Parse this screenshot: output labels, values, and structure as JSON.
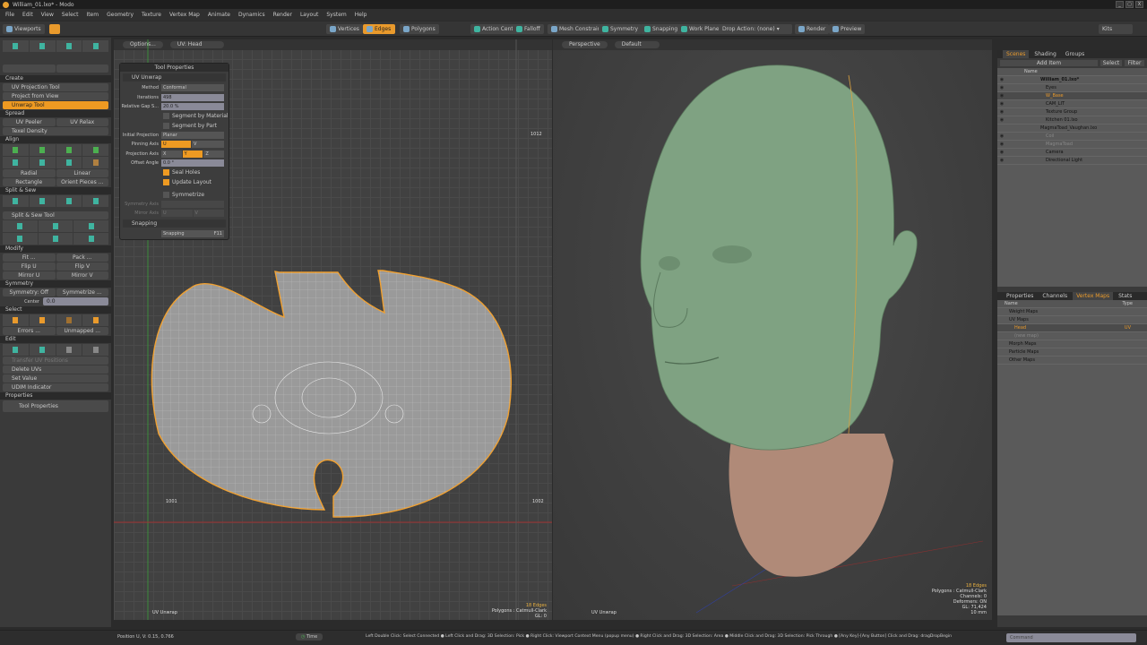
{
  "window": {
    "title": "William_01.lxo* - Modo",
    "buttons": [
      "_",
      "▢",
      "X"
    ]
  },
  "menu": [
    "File",
    "Edit",
    "View",
    "Select",
    "Item",
    "Geometry",
    "Texture",
    "Vertex Map",
    "Animate",
    "Dynamics",
    "Render",
    "Layout",
    "System",
    "Help"
  ],
  "toolbar": {
    "layout": "Viewports",
    "vertices": "Vertices",
    "edges": "Edges",
    "polygons": "Polygons",
    "action_center": "Action Center",
    "falloff": "Falloff",
    "mesh_constraint": "Mesh Constraint",
    "symmetry": "Symmetry",
    "snapping": "Snapping",
    "work_plane": "Work Plane",
    "drop_action": "Drop Action: (none)",
    "render": "Render",
    "preview": "Preview",
    "kits": "Kits"
  },
  "left_panel": {
    "create_header": "Create",
    "create_items": [
      "UV Projection Tool",
      "Project from View",
      "Unwrap Tool"
    ],
    "spread_header": "Spread",
    "uv_peeler": "UV Peeler",
    "uv_relax": "UV Relax",
    "texel_density": "Texel Density",
    "align_header": "Align",
    "radial": "Radial",
    "linear": "Linear",
    "rectangle": "Rectangle",
    "orient_pieces": "Orient Pieces ...",
    "split_header": "Split & Sew",
    "split_tool": "Split & Sew Tool",
    "modify_header": "Modify",
    "fit": "Fit ...",
    "pack": "Pack ...",
    "flip_u": "Flip U",
    "flip_v": "Flip V",
    "mirror_u": "Mirror U",
    "mirror_v": "Mirror V",
    "symmetry_header": "Symmetry",
    "symmetry_off": "Symmetry: Off",
    "symmetrize": "Symmetrize ...",
    "center_label": "Center",
    "center_value": "0.0",
    "select_header": "Select",
    "errors": "Errors ...",
    "unmapped": "Unmapped ...",
    "edit_header": "Edit",
    "transfer": "Transfer UV Positions",
    "delete_uvs": "Delete UVs",
    "set_value": "Set Value",
    "udim": "UDIM Indicator",
    "properties_header": "Properties",
    "tool_properties": "Tool Properties"
  },
  "uv_view": {
    "options": "Options...",
    "map": "UV: Head",
    "label": "UV Unwrap",
    "tick_1012": "1012",
    "tick_1001": "1001",
    "tick_1002": "1002"
  },
  "tool_properties": {
    "title": "Tool Properties",
    "section": "UV Unwrap",
    "method_label": "Method",
    "method": "Conformal",
    "iterations_label": "Iterations",
    "iterations": "498",
    "gap_label": "Relative Gap S...",
    "gap": "20.0 %",
    "seg_material": "Segment by Material",
    "seg_part": "Segment by Part",
    "init_proj_label": "Initial Projection",
    "init_proj": "Planar",
    "pin_label": "Pinning Axis",
    "pin_u": "U",
    "pin_v": "V",
    "proj_label": "Projection Axis",
    "proj_x": "X",
    "proj_y": "Y",
    "proj_z": "Z",
    "offset_label": "Offset Angle",
    "offset": "0.0 °",
    "seal_holes": "Seal Holes",
    "update_layout": "Update Layout",
    "symmetrize": "Symmetrize",
    "sym_axis_label": "Symmetry Axis",
    "mirror_axis_label": "Mirror Axis",
    "mirror_u": "U",
    "mirror_v": "V",
    "snapping_section": "Snapping",
    "snapping": "Snapping",
    "snapping_key": "F11"
  },
  "view3d": {
    "projection": "Perspective",
    "style": "Default",
    "label": "UV Unwrap",
    "info_left": [
      "18 Edges",
      "Polygons : Catmull-Clark",
      "GL: 0"
    ],
    "info_right": [
      "18 Edges",
      "Polygons : Catmull-Clark",
      "Channels: 0",
      "Deformers: ON",
      "GL: 71,424",
      "10 mm"
    ]
  },
  "scene": {
    "tabs": [
      "Scenes",
      "Shading",
      "Groups"
    ],
    "add_item": "Add Item",
    "select": "Select",
    "filter": "Filter",
    "col_name": "Name",
    "items": [
      "William_01.lxo*",
      "Eyes",
      "W_Base",
      "CAM_LIT",
      "Texture Group",
      "Kitchen 01.lxo",
      "MagmaToad_Vaughan.lxo",
      "Coil",
      "MagmaToad",
      "Camera",
      "Directional Light"
    ]
  },
  "vmaps": {
    "tabs": [
      "Properties",
      "Channels",
      "Vertex Maps",
      "Stats"
    ],
    "col_name": "Name",
    "col_type": "Type",
    "items": [
      "Weight Maps",
      "UV Maps",
      "Head",
      "(new map)",
      "Morph Maps",
      "Particle Maps",
      "Other Maps"
    ],
    "head_type": "UV"
  },
  "status": {
    "position": "Position U, V:  0.15, 0.766",
    "time": "Time",
    "hint": "Left Double Click: Select Connected ● Left Click and Drag: 3D Selection: Pick ● Right Click: Viewport Context Menu (popup menu) ● Right Click and Drag: 3D Selection: Area ● Middle Click and Drag: 3D Selection: Pick Through ● [Any Key]-[Any Button] Click and Drag: dragDropBegin",
    "command_placeholder": "Command"
  },
  "colors": {
    "accent": "#e99a2c",
    "skin": "#7fa282",
    "neck": "#b08a78"
  }
}
